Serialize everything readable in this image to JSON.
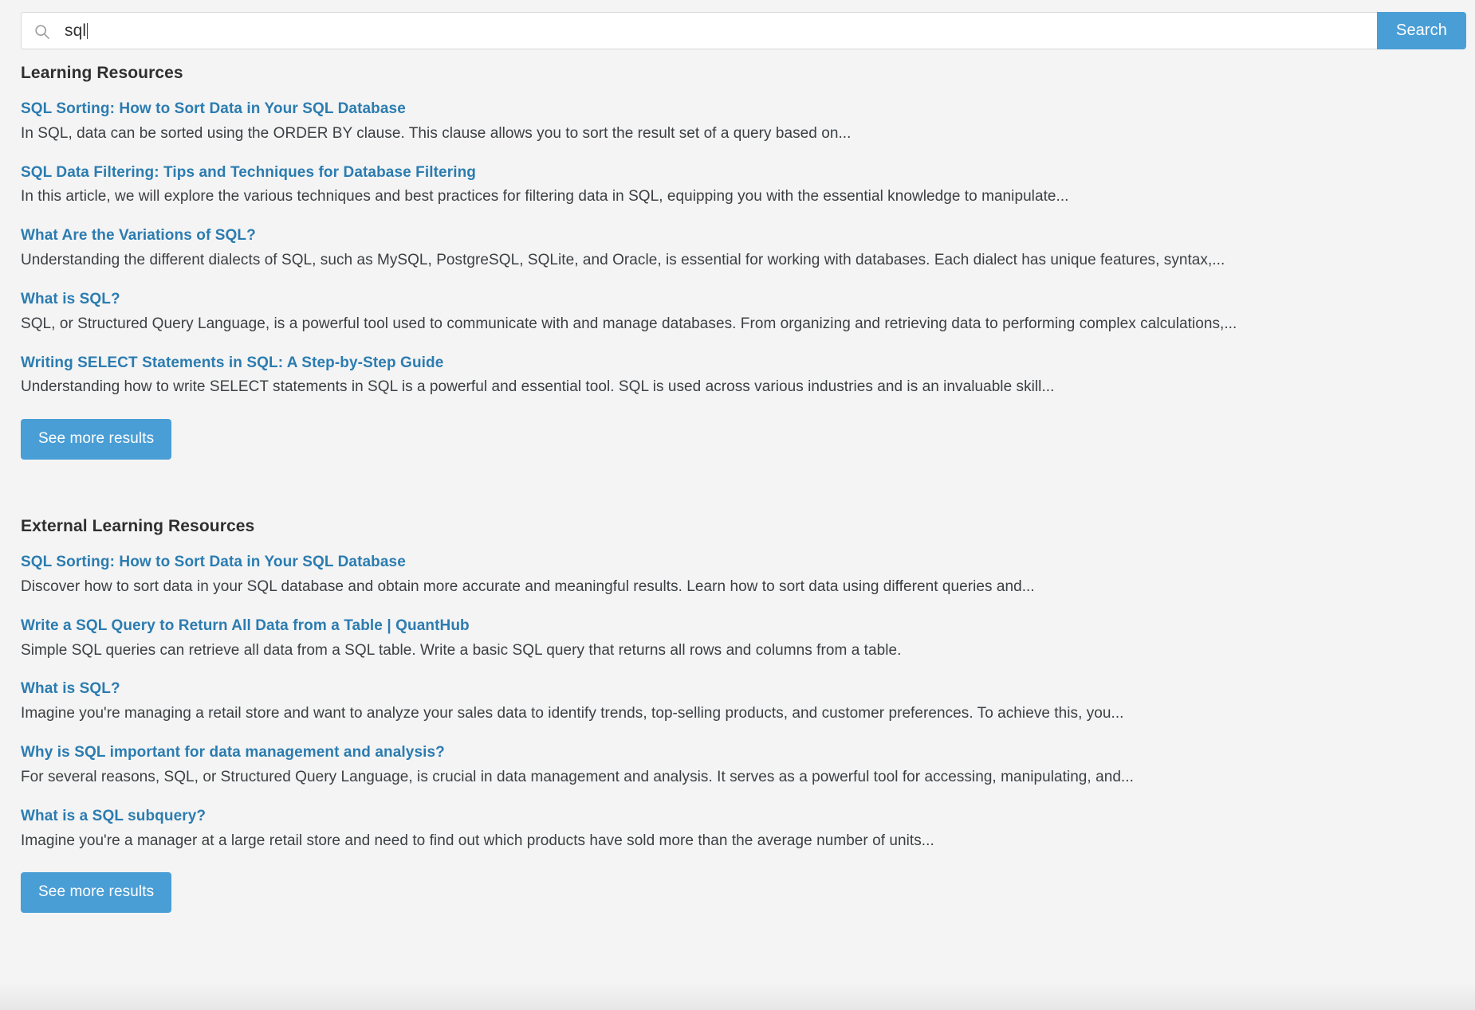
{
  "search": {
    "value": "sql",
    "placeholder": "Search",
    "icon": "search-icon",
    "button_label": "Search",
    "accent_color": "#4a9ed6"
  },
  "sections": [
    {
      "title": "Learning Resources",
      "more_label": "See more results",
      "results": [
        {
          "title": "SQL Sorting: How to Sort Data in Your SQL Database",
          "snippet": "In SQL, data can be sorted using the ORDER BY clause. This clause allows you to sort the result set of a query based on..."
        },
        {
          "title": "SQL Data Filtering: Tips and Techniques for Database Filtering",
          "snippet": "In this article, we will explore the various techniques and best practices for filtering data in SQL, equipping you with the essential knowledge to manipulate..."
        },
        {
          "title": "What Are the Variations of SQL?",
          "snippet": "Understanding the different dialects of SQL, such as MySQL, PostgreSQL, SQLite, and Oracle, is essential for working with databases. Each dialect has unique features, syntax,..."
        },
        {
          "title": "What is SQL?",
          "snippet": "SQL, or Structured Query Language, is a powerful tool used to communicate with and manage databases. From organizing and retrieving data to performing complex calculations,..."
        },
        {
          "title": "Writing SELECT Statements in SQL: A Step-by-Step Guide",
          "snippet": "Understanding how to write SELECT statements in SQL is a powerful and essential tool. SQL is used across various industries and is an invaluable skill..."
        }
      ]
    },
    {
      "title": "External Learning Resources",
      "more_label": "See more results",
      "results": [
        {
          "title": "SQL Sorting: How to Sort Data in Your SQL Database",
          "snippet": "Discover how to sort data in your SQL database and obtain more accurate and meaningful results. Learn how to sort data using different queries and..."
        },
        {
          "title": "Write a SQL Query to Return All Data from a Table | QuantHub",
          "snippet": "Simple SQL queries can retrieve all data from a SQL table. Write a basic SQL query that returns all rows and columns from a table."
        },
        {
          "title": "What is SQL?",
          "snippet": "Imagine you're managing a retail store and want to analyze your sales data to identify trends, top-selling products, and customer preferences. To achieve this, you..."
        },
        {
          "title": "Why is SQL important for data management and analysis?",
          "snippet": "For several reasons, SQL, or Structured Query Language, is crucial in data management and analysis. It serves as a powerful tool for accessing, manipulating, and..."
        },
        {
          "title": "What is a SQL subquery?",
          "snippet": "Imagine you're a manager at a large retail store and need to find out which products have sold more than the average number of units..."
        }
      ]
    }
  ]
}
